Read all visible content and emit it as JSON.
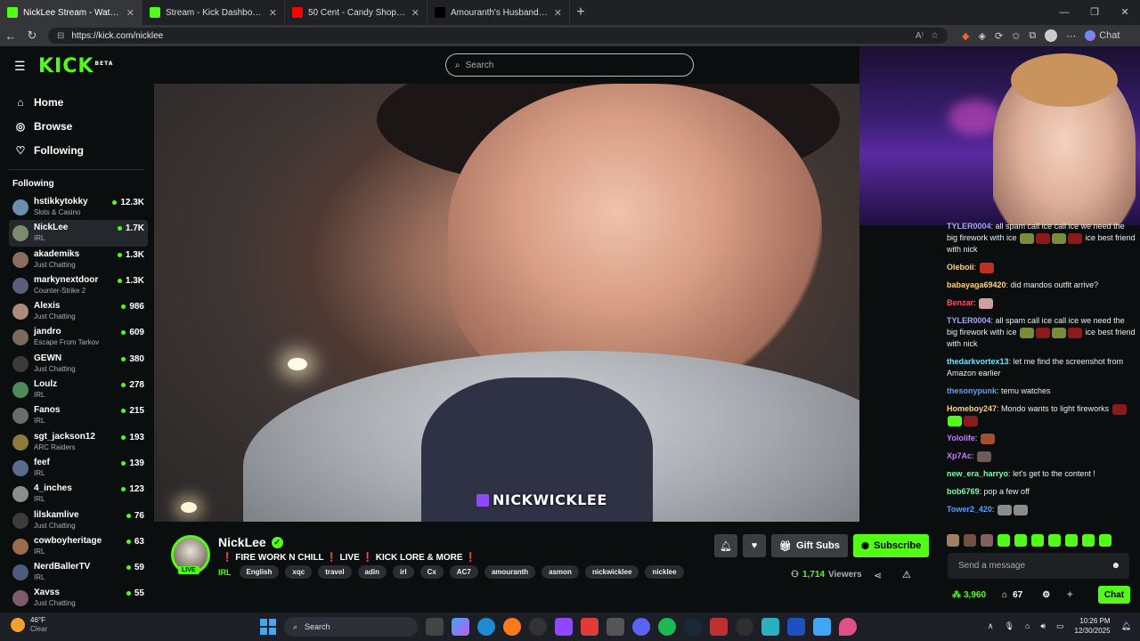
{
  "browser": {
    "tabs": [
      {
        "title": "NickLee Stream - Watch Live o",
        "icon": "kick-icon",
        "color": "#53fc18",
        "active": true
      },
      {
        "title": "Stream - Kick Dashboard",
        "icon": "kick-icon",
        "color": "#53fc18",
        "active": false
      },
      {
        "title": "50 Cent - Candy Shop (Official Mu",
        "icon": "youtube-icon",
        "color": "#ff0000",
        "active": false
      },
      {
        "title": "Amouranth's Husband (@nickwick",
        "icon": "x-icon",
        "color": "#000000",
        "active": false
      }
    ],
    "url": "https://kick.com/nicklee",
    "copilot_label": "Chat"
  },
  "header": {
    "logo": "KICK",
    "logo_badge": "BETA",
    "search_placeholder": "Search"
  },
  "sidebar": {
    "nav": [
      {
        "label": "Home",
        "icon": "home-icon"
      },
      {
        "label": "Browse",
        "icon": "compass-icon"
      },
      {
        "label": "Following",
        "icon": "heart-icon"
      }
    ],
    "following_title": "Following",
    "following": [
      {
        "name": "hstikkytokky",
        "category": "Slots & Casino",
        "viewers": "12.3K",
        "color": "#6a8fb0"
      },
      {
        "name": "NickLee",
        "category": "IRL",
        "viewers": "1.7K",
        "color": "#7b8c6c",
        "selected": true
      },
      {
        "name": "akademiks",
        "category": "Just Chatting",
        "viewers": "1.3K",
        "color": "#8a6d5c"
      },
      {
        "name": "markynextdoor",
        "category": "Counter-Strike 2",
        "viewers": "1.3K",
        "color": "#5c5f7a"
      },
      {
        "name": "Alexis",
        "category": "Just Chatting",
        "viewers": "986",
        "color": "#b08a7a"
      },
      {
        "name": "jandro",
        "category": "Escape From Tarkov",
        "viewers": "609",
        "color": "#7a6a5c"
      },
      {
        "name": "GEWN",
        "category": "Just Chatting",
        "viewers": "380",
        "color": "#3b3b3b"
      },
      {
        "name": "Loulz",
        "category": "IRL",
        "viewers": "278",
        "color": "#4c8c5c"
      },
      {
        "name": "Fanos",
        "category": "IRL",
        "viewers": "215",
        "color": "#6c6c6c"
      },
      {
        "name": "sgt_jackson12",
        "category": "ARC Raiders",
        "viewers": "193",
        "color": "#8c7a3c"
      },
      {
        "name": "feef",
        "category": "IRL",
        "viewers": "139",
        "color": "#5a6c8c"
      },
      {
        "name": "4_inches",
        "category": "IRL",
        "viewers": "123",
        "color": "#8c8c8c"
      },
      {
        "name": "lilskamlive",
        "category": "Just Chatting",
        "viewers": "76",
        "color": "#3c3c3c"
      },
      {
        "name": "cowboyheritage",
        "category": "IRL",
        "viewers": "63",
        "color": "#9a6c4c"
      },
      {
        "name": "NerdBallerTV",
        "category": "IRL",
        "viewers": "59",
        "color": "#4c5c7c"
      },
      {
        "name": "Xavss",
        "category": "Just Chatting",
        "viewers": "55",
        "color": "#7c5c6c"
      }
    ]
  },
  "video": {
    "watermark": "NICKWICKLEE"
  },
  "chat": {
    "messages": [
      {
        "user": "TYLER0004",
        "color": "#9fa8ff",
        "text": "all spam call ice call ice we need the big firework with ice",
        "emotes": [
          "#7a8c3c",
          "#8c1a1a",
          "#7a8c3c",
          "#8c1a1a"
        ],
        "tail": "ice best friend with nick"
      },
      {
        "user": "Oleboii",
        "color": "#ffd27f",
        "text": "",
        "emotes": [
          "#c03020"
        ]
      },
      {
        "user": "babayaga69420",
        "color": "#ffd27f",
        "text": "did mandos outfit arrive?",
        "emotes": []
      },
      {
        "user": "Benzar",
        "color": "#ff4d6d",
        "text": "",
        "emotes": [
          "#d0a0a0"
        ]
      },
      {
        "user": "TYLER0004",
        "color": "#9fa8ff",
        "text": "all spam call ice call ice we need the big firework with ice",
        "emotes": [
          "#7a8c3c",
          "#8c1a1a",
          "#7a8c3c",
          "#8c1a1a"
        ],
        "tail": "ice best friend with nick"
      },
      {
        "user": "thedarkvortex13",
        "color": "#6fe3ff",
        "text": "let me find the screenshot from Amazon earlier",
        "emotes": []
      },
      {
        "user": "thesonypunk",
        "color": "#5aa0ff",
        "text": "temu watches",
        "emotes": []
      },
      {
        "user": "Homeboy247",
        "color": "#ffd27f",
        "text": "Mondo wants to light fireworks",
        "emotes": [
          "#8c1a1a",
          "#53fc18",
          "#8c1a1a"
        ]
      },
      {
        "user": "Yololife",
        "color": "#c77dff",
        "text": "",
        "emotes": [
          "#a05030"
        ]
      },
      {
        "user": "Xp7Ac",
        "color": "#c77dff",
        "text": "",
        "emotes": [
          "#6c5c5c"
        ]
      },
      {
        "user": "new_era_harryo",
        "color": "#7dffb0",
        "text": "let's get to the content !",
        "emotes": []
      },
      {
        "user": "bob6769",
        "color": "#7dffb0",
        "text": "pop a few off",
        "emotes": []
      },
      {
        "user": "Tower2_420",
        "color": "#5aa0ff",
        "text": "",
        "emotes": [
          "#8c8c8c",
          "#8c8c8c"
        ]
      }
    ],
    "input_placeholder": "Send a message",
    "points": "3,960",
    "gifts": "67",
    "chat_button": "Chat"
  },
  "stream": {
    "channel": "NickLee",
    "live_label": "LIVE",
    "title_parts": [
      "FIRE WORK N CHILL",
      "LIVE",
      "KICK LORE & MORE"
    ],
    "category": "IRL",
    "tags": [
      "English",
      "xqc",
      "travel",
      "adin",
      "irl",
      "Cx",
      "AC7",
      "amouranth",
      "asmon",
      "nickwicklee",
      "nicklee"
    ],
    "gift_label": "Gift Subs",
    "subscribe_label": "Subscribe",
    "viewers_count": "1,714",
    "viewers_label": "Viewers"
  },
  "taskbar": {
    "temp": "46°F",
    "weather": "Clear",
    "search_label": "Search",
    "time": "10:26 PM",
    "date": "12/30/2025"
  }
}
